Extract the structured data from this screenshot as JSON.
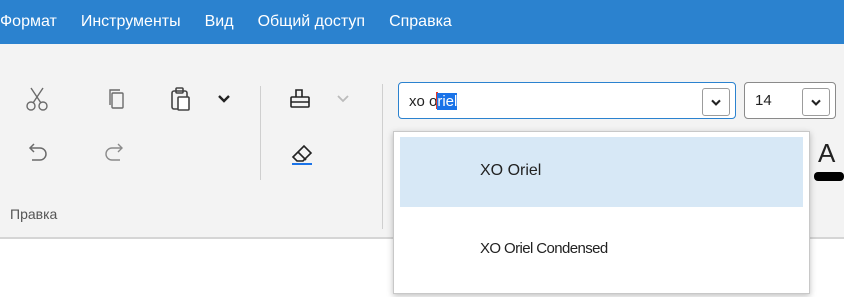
{
  "menu": [
    "Формат",
    "Инструменты",
    "Вид",
    "Общий доступ",
    "Справка"
  ],
  "ribbon": {
    "group_label": "Правка",
    "icons": {
      "cut": "scissors-icon",
      "copy": "copy-icon",
      "paste": "paste-icon",
      "paste_dropdown": "chevron-down-icon",
      "format_painter": "format-painter-icon",
      "undo": "undo-icon",
      "redo": "redo-icon",
      "clear_format": "eraser-icon"
    }
  },
  "font_select": {
    "typed": "xo o",
    "selected_completion": "riel"
  },
  "size_select": {
    "value": "14"
  },
  "font_dropdown": {
    "items": [
      {
        "label": "XO Oriel",
        "selected": true
      },
      {
        "label": "XO Oriel Condensed",
        "selected": false
      }
    ]
  },
  "font_color": {
    "letter": "A",
    "color": "#000000"
  },
  "colors": {
    "accent": "#2b82cf",
    "selection": "#1a73e8",
    "highlight": "#d7e8f6"
  }
}
